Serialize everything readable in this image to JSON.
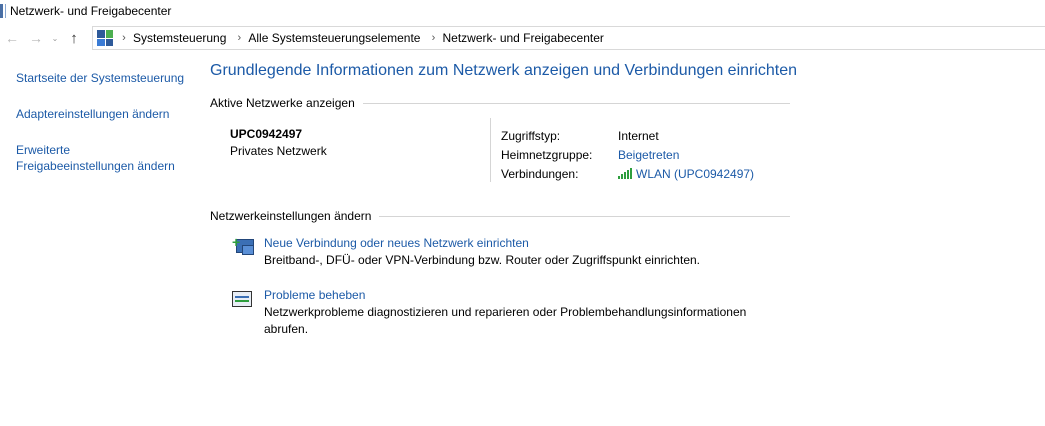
{
  "window": {
    "title": "Netzwerk- und Freigabecenter"
  },
  "nav": {
    "back": "←",
    "forward": "→",
    "dropdown": "⌄",
    "up": "↑",
    "separator": "›"
  },
  "address": {
    "crumbs": [
      "Systemsteuerung",
      "Alle Systemsteuerungselemente",
      "Netzwerk- und Freigabecenter"
    ]
  },
  "sidebar": {
    "items": [
      {
        "label": "Startseite der Systemsteuerung"
      },
      {
        "label": "Adaptereinstellungen ändern"
      },
      {
        "label": "Erweiterte Freigabeeinstellungen ändern"
      }
    ]
  },
  "main": {
    "title": "Grundlegende Informationen zum Netzwerk anzeigen und Verbindungen einrichten",
    "active_section": "Aktive Netzwerke anzeigen",
    "network": {
      "name": "UPC0942497",
      "type": "Privates Netzwerk",
      "properties": [
        {
          "label": "Zugriffstyp:",
          "value": "Internet"
        },
        {
          "label": "Heimnetzgruppe:",
          "value": "Beigetreten"
        },
        {
          "label": "Verbindungen:",
          "value": "WLAN (UPC0942497)"
        }
      ]
    },
    "settings_section": "Netzwerkeinstellungen ändern",
    "tasks": [
      {
        "link": "Neue Verbindung oder neues Netzwerk einrichten",
        "desc": "Breitband-, DFÜ- oder VPN-Verbindung bzw. Router oder Zugriffspunkt einrichten."
      },
      {
        "link": "Probleme beheben",
        "desc": "Netzwerkprobleme diagnostizieren und reparieren oder Problembehandlungsinformationen abrufen."
      }
    ]
  },
  "colors": {
    "link": "#1c5aa7",
    "divider": "#d5d5d5",
    "signal": "#2e9e3e"
  }
}
